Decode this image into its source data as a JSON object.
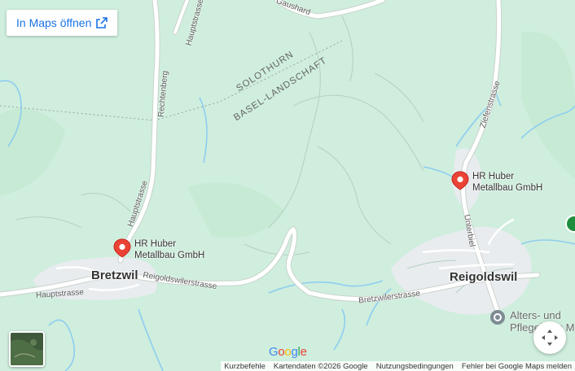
{
  "open_in_maps": {
    "label": "In Maps öffnen",
    "icon": "external-link-icon"
  },
  "colors": {
    "land": "#cfeedd",
    "road": "#ffffff",
    "water": "#8ecdf0",
    "pin": "#ea4335",
    "link": "#1a73e8",
    "settlement": "#e8ecef"
  },
  "regions": [
    "SOLOTHURN",
    "BASEL-LANDSCHAFT"
  ],
  "roads": {
    "gaushard": "Gaushard",
    "hauptstrasse_north": "Hauptstrasse",
    "rechtenberg": "Rechtenberg",
    "hauptstrasse_mid": "Hauptstrasse",
    "hauptstrasse_west": "Hauptstrasse",
    "reigoldswilerstrasse": "Reigoldswilerstrasse",
    "bretzwilerstrasse": "Bretzwilerstrasse",
    "ziefenstrasse": "Ziefenstrasse",
    "unterbiel": "Unterbiel"
  },
  "towns": {
    "bretzwil": "Bretzwil",
    "reigoldswil": "Reigoldswil"
  },
  "pins": [
    {
      "line1": "HR Huber",
      "line2": "Metallbau GmbH"
    },
    {
      "line1": "HR Huber",
      "line2": "Metallbau GmbH"
    }
  ],
  "poi": {
    "line1": "Alters- und",
    "line2": "Pflegeheim M",
    "icon": "place-marker-icon"
  },
  "google_logo": "Google",
  "footer": {
    "shortcuts": "Kurzbefehle",
    "map_data": "Kartendaten ©2026 Google",
    "terms": "Nutzungsbedingungen",
    "report": "Fehler bei Google Maps melden"
  }
}
